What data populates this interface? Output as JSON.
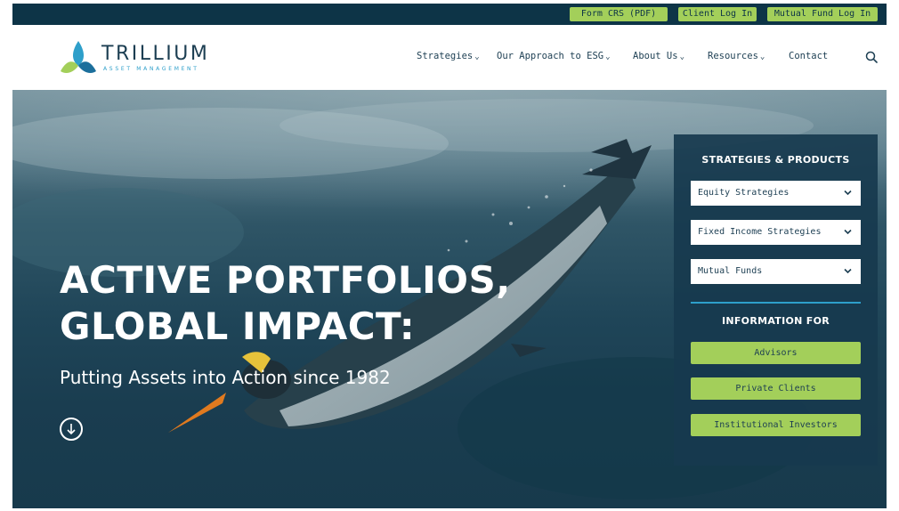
{
  "utility": {
    "form_crs": "Form CRS (PDF)",
    "client_login": "Client Log In",
    "mutual_fund_login": "Mutual Fund Log In"
  },
  "header": {
    "logo_name": "TRILLIUM",
    "logo_sub": "ASSET MANAGEMENT",
    "nav": [
      {
        "label": "Strategies",
        "has_dropdown": true
      },
      {
        "label": "Our Approach to ESG",
        "has_dropdown": true
      },
      {
        "label": "About Us",
        "has_dropdown": true
      },
      {
        "label": "Resources",
        "has_dropdown": true
      },
      {
        "label": "Contact",
        "has_dropdown": false
      }
    ],
    "search_icon": "search-icon"
  },
  "hero": {
    "title_line1": "ACTIVE PORTFOLIOS,",
    "title_line2": "GLOBAL IMPACT:",
    "subtitle": "Putting Assets into Action since 1982",
    "scroll_icon": "arrow-down-circle-icon"
  },
  "panel": {
    "strategies_heading": "STRATEGIES & PRODUCTS",
    "dropdowns": [
      {
        "label": "Equity Strategies"
      },
      {
        "label": "Fixed Income Strategies"
      },
      {
        "label": "Mutual Funds"
      }
    ],
    "info_heading": "INFORMATION FOR",
    "buttons": [
      {
        "label": "Advisors"
      },
      {
        "label": "Private Clients"
      },
      {
        "label": "Institutional Investors"
      }
    ]
  },
  "colors": {
    "navy": "#0d3447",
    "accent_green": "#a3cf5a",
    "accent_blue": "#2e9fca",
    "text_dark": "#1c3e52"
  }
}
